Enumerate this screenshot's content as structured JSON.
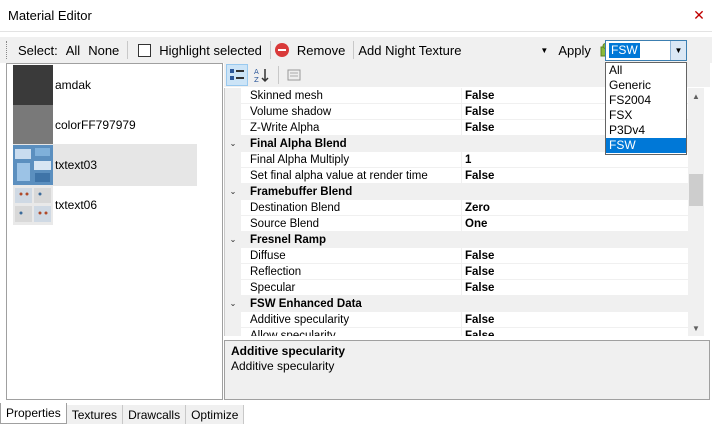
{
  "window": {
    "title": "Material Editor"
  },
  "toolbar": {
    "select_label": "Select:",
    "all_label": "All",
    "none_label": "None",
    "highlight_label": "Highlight selected",
    "highlight_checked": false,
    "remove_label": "Remove",
    "night_texture_label": "Add Night Texture",
    "apply_label": "Apply",
    "platform_value": "FSW"
  },
  "platform_dropdown": {
    "options": [
      "All",
      "Generic",
      "FS2004",
      "FSX",
      "P3Dv4",
      "FSW"
    ],
    "selected": "FSW"
  },
  "materials": [
    {
      "name": "amdak",
      "selected": false
    },
    {
      "name": "colorFF797979",
      "selected": false
    },
    {
      "name": "txtext03",
      "selected": true
    },
    {
      "name": "txtext06",
      "selected": false
    }
  ],
  "properties": [
    {
      "type": "prop",
      "name": "Skinned mesh",
      "value": "False"
    },
    {
      "type": "prop",
      "name": "Volume shadow",
      "value": "False"
    },
    {
      "type": "prop",
      "name": "Z-Write Alpha",
      "value": "False"
    },
    {
      "type": "cat",
      "name": "Final Alpha Blend"
    },
    {
      "type": "prop",
      "name": "Final Alpha Multiply",
      "value": "1"
    },
    {
      "type": "prop",
      "name": "Set final alpha value at render time",
      "value": "False"
    },
    {
      "type": "cat",
      "name": "Framebuffer Blend"
    },
    {
      "type": "prop",
      "name": "Destination Blend",
      "value": "Zero"
    },
    {
      "type": "prop",
      "name": "Source Blend",
      "value": "One"
    },
    {
      "type": "cat",
      "name": "Fresnel Ramp"
    },
    {
      "type": "prop",
      "name": "Diffuse",
      "value": "False"
    },
    {
      "type": "prop",
      "name": "Reflection",
      "value": "False"
    },
    {
      "type": "prop",
      "name": "Specular",
      "value": "False"
    },
    {
      "type": "cat",
      "name": "FSW Enhanced Data"
    },
    {
      "type": "prop",
      "name": "Additive specularity",
      "value": "False"
    },
    {
      "type": "prop",
      "name": "Allow specularity...",
      "value": "False"
    }
  ],
  "help": {
    "title": "Additive specularity",
    "description": "Additive specularity"
  },
  "tabs": [
    {
      "label": "Properties",
      "active": true
    },
    {
      "label": "Textures",
      "active": false
    },
    {
      "label": "Drawcalls",
      "active": false
    },
    {
      "label": "Optimize",
      "active": false
    }
  ],
  "colors": {
    "accent": "#0078d7",
    "close": "#c00000",
    "remove": "#d93a3a"
  }
}
